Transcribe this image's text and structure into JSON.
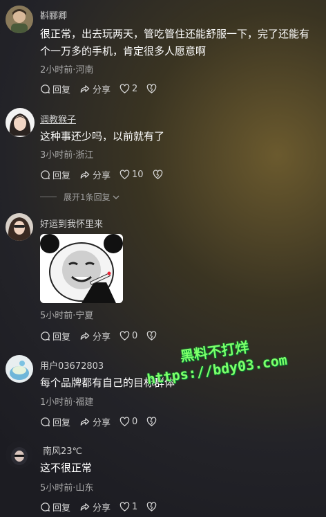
{
  "comments": [
    {
      "name": "斟郦卿",
      "text": "很正常，出去玩两天，管吃管住还能舒服一下，完了还能有个一万多的手机，肯定很多人愿意啊",
      "meta": "2小时前·河南",
      "reply": "回复",
      "share": "分享",
      "likes": "2"
    },
    {
      "name": "调教猴子",
      "text": "这种事还少吗，以前就有了",
      "meta": "3小时前·浙江",
      "reply": "回复",
      "share": "分享",
      "likes": "10",
      "expand": "展开1条回复"
    },
    {
      "name": "好运到我怀里来",
      "meta": "5小时前·宁夏",
      "reply": "回复",
      "share": "分享",
      "likes": "0"
    },
    {
      "name": "用户03672803",
      "text": "每个品牌都有自己的目标群体",
      "meta": "1小时前·福建",
      "reply": "回复",
      "share": "分享",
      "likes": "0"
    },
    {
      "name": "南风23℃",
      "text": "这不很正常",
      "meta": "5小时前·山东",
      "reply": "回复",
      "share": "分享",
      "likes": "1"
    }
  ],
  "watermark": {
    "line1": "黑料不打烊",
    "line2": "https://bdy03.com"
  },
  "colors": {
    "watermark": "#7dff6a",
    "text": "#ffffff",
    "meta": "#a9a9a9"
  }
}
